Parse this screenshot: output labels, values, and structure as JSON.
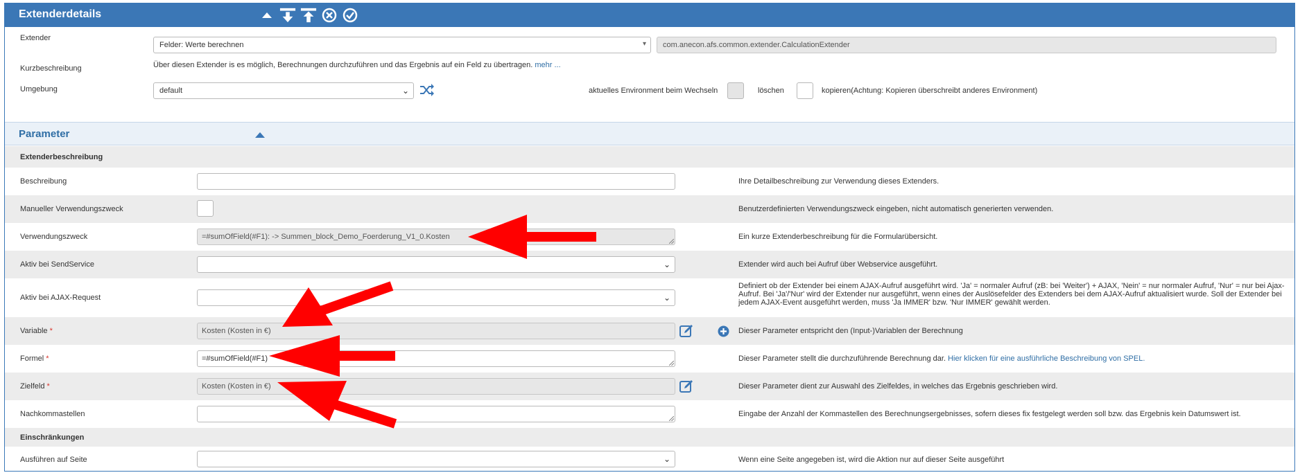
{
  "header": {
    "title": "Extenderdetails",
    "icons": [
      "collapse-up-icon",
      "move-down-icon",
      "move-up-icon",
      "cancel-icon",
      "confirm-icon"
    ]
  },
  "extender": {
    "label": "Extender",
    "select_value": "Felder: Werte berechnen",
    "class_name": "com.anecon.afs.common.extender.CalculationExtender"
  },
  "kurz": {
    "label": "Kurzbeschreibung",
    "text": "Über diesen Extender is es möglich, Berechnungen durchzuführen und das Ergebnis auf ein Feld zu übertragen.",
    "more": "mehr ..."
  },
  "umgebung": {
    "label": "Umgebung",
    "select_value": "default",
    "env_label": "aktuelles Environment beim Wechseln",
    "delete_label": "löschen",
    "copy_label": "kopieren(Achtung: Kopieren überschreibt anderes Environment)"
  },
  "parameter": {
    "title": "Parameter",
    "section1": "Extenderbeschreibung",
    "section2": "Einschränkungen",
    "rows": {
      "beschreibung": {
        "label": "Beschreibung",
        "value": "",
        "desc": "Ihre Detailbeschreibung zur Verwendung dieses Extenders."
      },
      "manuell": {
        "label": "Manueller Verwendungszweck",
        "desc": "Benutzerdefinierten Verwendungszweck eingeben, nicht automatisch generierten verwenden."
      },
      "zweck": {
        "label": "Verwendungszweck",
        "value": "=#sumOfField(#F1):  -> Summen_block_Demo_Foerderung_V1_0.Kosten",
        "desc": "Ein kurze Extenderbeschreibung für die Formularübersicht."
      },
      "send": {
        "label": "Aktiv bei SendService",
        "value": "",
        "desc": "Extender wird auch bei Aufruf über Webservice ausgeführt."
      },
      "ajax": {
        "label": "Aktiv bei AJAX-Request",
        "value": "",
        "desc": "Definiert ob der Extender bei einem AJAX-Aufruf ausgeführt wird. 'Ja' = normaler Aufruf (zB: bei 'Weiter') + AJAX, 'Nein' = nur normaler Aufruf, 'Nur' = nur bei Ajax-Aufruf. Bei 'Ja'/'Nur' wird der Extender nur ausgeführt, wenn eines der Auslösefelder des Extenders bei dem AJAX-Aufruf aktualisiert wurde. Soll der Extender bei jedem AJAX-Event ausgeführt werden, muss 'Ja IMMER' bzw. 'Nur IMMER' gewählt werden."
      },
      "variable": {
        "label": "Variable",
        "required": "*",
        "value": "Kosten (Kosten in €)",
        "desc": "Dieser Parameter entspricht den (Input-)Variablen der Berechnung"
      },
      "formel": {
        "label": "Formel",
        "required": "*",
        "value": "=#sumOfField(#F1)",
        "desc": "Dieser Parameter stellt die durchzuführende Berechnung dar.",
        "link": "Hier klicken für eine ausführliche Beschreibung von SPEL."
      },
      "zielfeld": {
        "label": "Zielfeld",
        "required": "*",
        "value": "Kosten (Kosten in €)",
        "desc": "Dieser Parameter dient zur Auswahl des Zielfeldes, in welches das Ergebnis geschrieben wird."
      },
      "nachkomma": {
        "label": "Nachkommastellen",
        "value": "",
        "desc": "Eingabe der Anzahl der Kommastellen des Berechnungsergebnisses, sofern dieses fix festgelegt werden soll bzw. das Ergebnis kein Datumswert ist."
      },
      "seite": {
        "label": "Ausführen auf Seite",
        "value": "",
        "desc": "Wenn eine Seite angegeben ist, wird die Aktion nur auf dieser Seite ausgeführt"
      }
    }
  },
  "colors": {
    "accent": "#3b77b6",
    "arrow": "#ff0000",
    "row_alt": "#ececec"
  }
}
